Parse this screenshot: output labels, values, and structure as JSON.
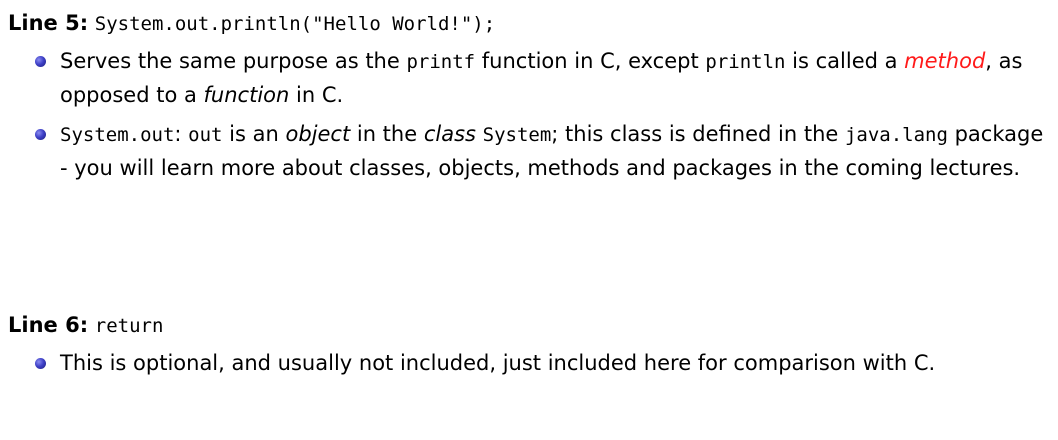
{
  "line5": {
    "label": "Line 5:",
    "code": "System.out.println(\"Hello World!\");",
    "bullets": [
      {
        "p1": "Serves the same purpose as the ",
        "c1": "printf",
        "p2": " function in C, except ",
        "c2": "println",
        "p3": " is called a ",
        "em_red": "method",
        "p4": ", as opposed to a ",
        "em": "function",
        "p5": " in C."
      },
      {
        "c1": "System.out",
        "p1": ": ",
        "c2": "out",
        "p2": " is an ",
        "em1": "object",
        "p3": " in the ",
        "em2": "class",
        "p4": " ",
        "c3": "System",
        "p5": "; this class is defined in the ",
        "c4": "java.lang",
        "p6": " package - you will learn more about classes, objects, methods and packages in the coming lectures."
      }
    ]
  },
  "line6": {
    "label": "Line 6:",
    "code": "return",
    "bullets": [
      {
        "text": "This is optional, and usually not included, just included here for comparison with C."
      }
    ]
  }
}
